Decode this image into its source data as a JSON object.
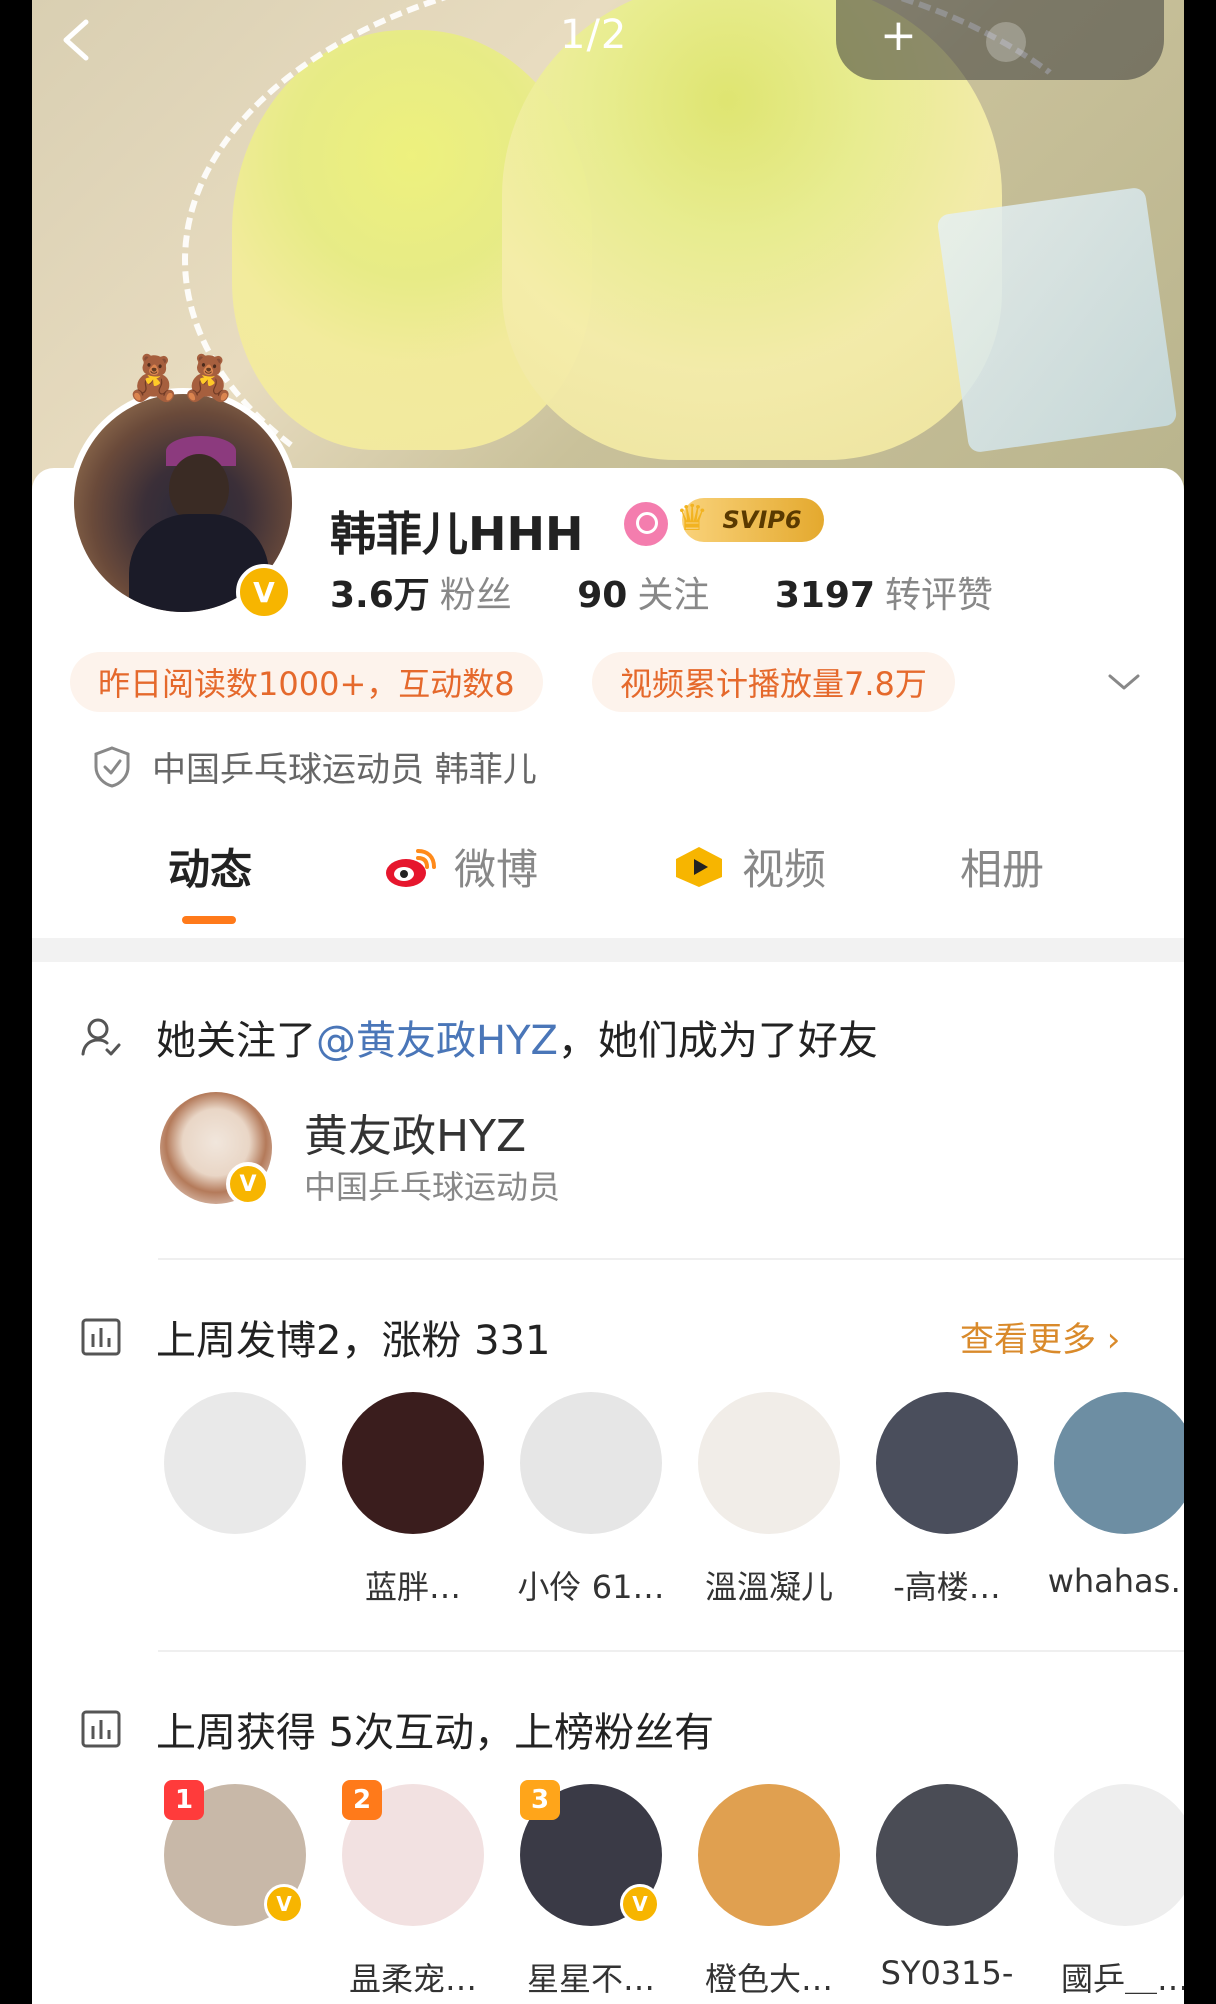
{
  "top_bar": {
    "page_counter": "1/2",
    "plus_label": "+"
  },
  "profile": {
    "name": "韩菲儿HHH",
    "svip_label": "SVIP6",
    "followers_value": "3.6万",
    "followers_label": "粉丝",
    "following_value": "90",
    "following_label": "关注",
    "interactions_value": "3197",
    "interactions_label": "转评赞",
    "tag_reads": "昨日阅读数1000+，互动数8",
    "tag_video": "视频累计播放量7.8万",
    "certification": "中国乒乓球运动员 韩菲儿"
  },
  "tabs": [
    {
      "label": "动态",
      "active": true,
      "icon": "none"
    },
    {
      "label": "微博",
      "active": false,
      "icon": "weibo-icon"
    },
    {
      "label": "视频",
      "active": false,
      "icon": "video-icon"
    },
    {
      "label": "相册",
      "active": false,
      "icon": "none"
    }
  ],
  "feed": {
    "follow_event": {
      "prefix": "她关注了",
      "mention": "@黄友政HYZ",
      "suffix": "，她们成为了好友",
      "friend_name": "黄友政HYZ",
      "friend_desc": "中国乒乓球运动员"
    },
    "weekly_posts": {
      "text": "上周发博2，涨粉 331",
      "more_link": "查看更多",
      "users": [
        {
          "name": "",
          "avatar": "#e9e9e9"
        },
        {
          "name": "蓝胖…",
          "avatar": "#3a1d1d"
        },
        {
          "name": "小伶 61…",
          "avatar": "#e6e6e6"
        },
        {
          "name": "溫溫凝儿",
          "avatar": "#f1ede8"
        },
        {
          "name": "-高楼…",
          "avatar": "#4a4e5c"
        },
        {
          "name": "whahas…",
          "avatar": "#6d8ea3"
        }
      ]
    },
    "weekly_interactions": {
      "text": "上周获得 5次互动，上榜粉丝有",
      "users": [
        {
          "rank": "1",
          "name": "",
          "avatar": "#c8b8a8",
          "verified": true,
          "rank_color": "#ff3b3b"
        },
        {
          "rank": "2",
          "name": "昷柔宠…",
          "avatar": "#f2e1e1",
          "verified": false,
          "rank_color": "#ff7a1a"
        },
        {
          "rank": "3",
          "name": "星星不…",
          "avatar": "#3a3a46",
          "verified": true,
          "rank_color": "#ffa51a"
        },
        {
          "rank": "",
          "name": "橙色大…",
          "avatar": "#e0a050",
          "verified": false,
          "rank_color": ""
        },
        {
          "rank": "",
          "name": "SY0315-",
          "avatar": "#4a4c55",
          "verified": false,
          "rank_color": ""
        },
        {
          "rank": "",
          "name": "國乒＿…",
          "avatar": "#eeeeee",
          "verified": false,
          "rank_color": ""
        }
      ]
    }
  },
  "colors": {
    "accent_orange": "#ff7a1a",
    "link_blue": "#4a76b8",
    "tag_bg": "#fdf3ec",
    "tag_text": "#e5692c",
    "verified_gold": "#f7b500"
  }
}
